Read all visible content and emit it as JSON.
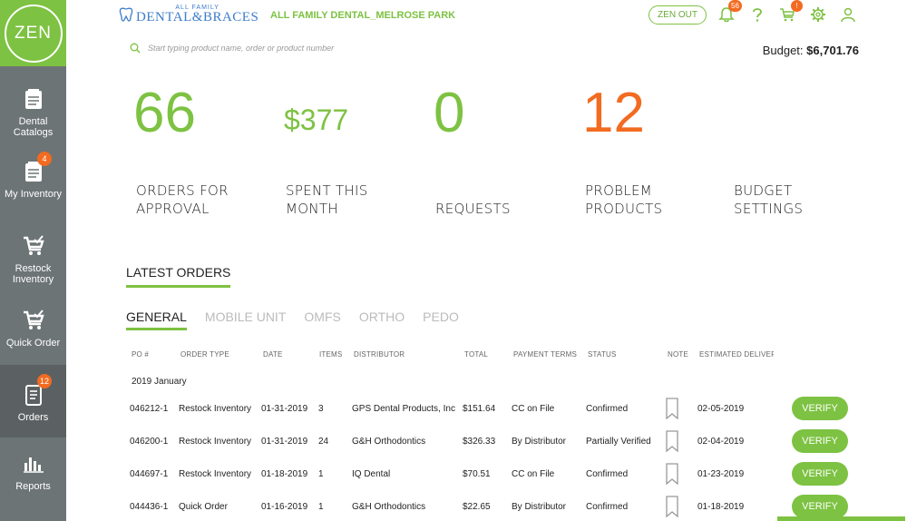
{
  "sidebar": {
    "logo": "ZEN",
    "items": [
      {
        "label": "Dental\nCatalogs",
        "icon": "catalog-icon"
      },
      {
        "label": "My Inventory",
        "icon": "inventory-icon",
        "badge": "4"
      },
      {
        "label": "Restock\nInventory",
        "icon": "restock-cart-icon"
      },
      {
        "label": "Quick Order",
        "icon": "quick-order-cart-icon"
      },
      {
        "label": "Orders",
        "icon": "orders-icon",
        "badge": "12"
      },
      {
        "label": "Reports",
        "icon": "reports-icon"
      }
    ]
  },
  "header": {
    "brand_small": "ALL FAMILY",
    "brand_big": "DENTAL&BRACES",
    "clinic": "ALL FAMILY DENTAL_MELROSE PARK",
    "zen_out": "ZEN OUT",
    "notifications_badge": "56",
    "cart_badge": "!"
  },
  "search": {
    "placeholder": "Start typing product name, order or product number"
  },
  "budget": {
    "label": "Budget:",
    "value": "$6,701.76"
  },
  "stats": [
    {
      "value": "66",
      "label": "ORDERS FOR APPROVAL",
      "color": "#7dc242"
    },
    {
      "value": "$377",
      "label": "SPENT THIS MONTH",
      "color": "#7dc242"
    },
    {
      "value": "0",
      "label": "REQUESTS",
      "color": "#7dc242"
    },
    {
      "value": "12",
      "label": "PROBLEM PRODUCTS",
      "color": "#f26b21"
    },
    {
      "value": "",
      "label": "BUDGET SETTINGS",
      "color": "#7dc242"
    }
  ],
  "latest_orders": {
    "title": "LATEST ORDERS",
    "tabs": [
      "GENERAL",
      "MOBILE UNIT",
      "OMFS",
      "ORTHO",
      "PEDO"
    ],
    "columns": [
      "PO #",
      "ORDER TYPE",
      "DATE",
      "ITEMS",
      "DISTRIBUTOR",
      "TOTAL",
      "PAYMENT TERMS",
      "STATUS",
      "NOTE",
      "ESTIMATED DELIVERY"
    ],
    "month": "2019 January",
    "verify_label": "VERIFY",
    "rows": [
      [
        "046212-1",
        "Restock Inventory",
        "01-31-2019",
        "3",
        "GPS Dental Products, Inc",
        "$151.64",
        "CC on File",
        "Confirmed",
        "",
        "02-05-2019"
      ],
      [
        "046200-1",
        "Restock Inventory",
        "01-31-2019",
        "24",
        "G&H Orthodontics",
        "$326.33",
        "By Distributor",
        "Partially Verified",
        "",
        "02-04-2019"
      ],
      [
        "044697-1",
        "Restock Inventory",
        "01-18-2019",
        "1",
        "IQ Dental",
        "$70.51",
        "CC on File",
        "Confirmed",
        "",
        "01-23-2019"
      ],
      [
        "044436-1",
        "Quick Order",
        "01-16-2019",
        "1",
        "G&H Orthodontics",
        "$22.65",
        "By Distributor",
        "Confirmed",
        "",
        "01-18-2019"
      ]
    ]
  },
  "colors": {
    "accent": "#7dc242",
    "warning": "#f26b21",
    "sidebar": "#6d7475"
  }
}
